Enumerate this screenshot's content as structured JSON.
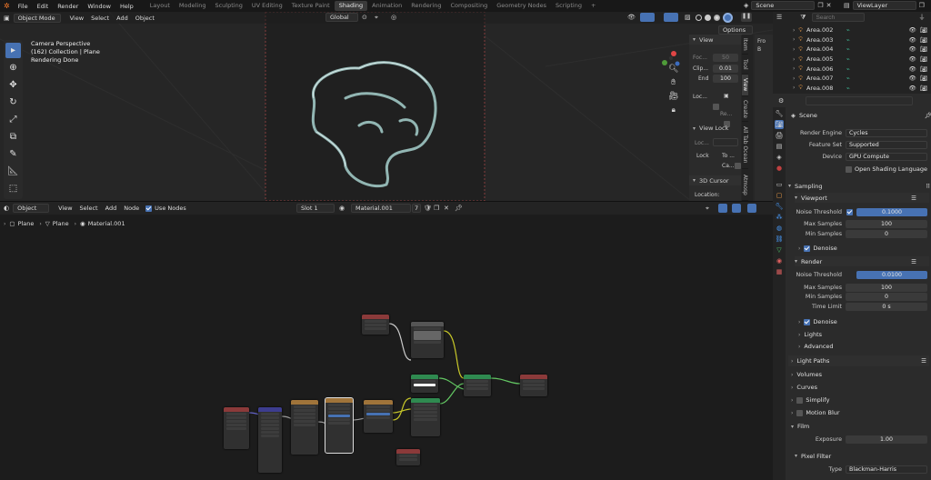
{
  "app_menu": [
    "File",
    "Edit",
    "Render",
    "Window",
    "Help"
  ],
  "workspaces": [
    "Layout",
    "Modeling",
    "Sculpting",
    "UV Editing",
    "Texture Paint",
    "Shading",
    "Animation",
    "Rendering",
    "Compositing",
    "Geometry Nodes",
    "Scripting",
    "+"
  ],
  "active_workspace": "Shading",
  "scene_name": "Scene",
  "view_layer": "ViewLayer",
  "viewport": {
    "mode": "Object Mode",
    "menus": [
      "View",
      "Select",
      "Add",
      "Object"
    ],
    "orientation": "Global",
    "options_label": "Options",
    "info": [
      "Camera Perspective",
      "(162) Collection | Plane",
      "Rendering Done"
    ]
  },
  "npanel": {
    "title": "View",
    "focal_label": "Foc...",
    "focal_value": "50",
    "clip_start_label": "Clip...",
    "clip_start_value": "0.01",
    "end_label": "End",
    "end_value": "100",
    "local_label": "Loc...",
    "render_label": "Re...",
    "view_lock": "View Lock",
    "lock_obj_label": "Loc...",
    "lock_label": "Lock",
    "to_label": "To ...",
    "cam_label": "Ca...",
    "cursor_title": "3D Cursor",
    "location_label": "Location:",
    "tabs": [
      "Item",
      "Tool",
      "View",
      "Create",
      "All Tab Ocean",
      "Atmosp"
    ],
    "active_tab": "View"
  },
  "node_editor": {
    "type": "Object",
    "menus": [
      "View",
      "Select",
      "Add",
      "Node"
    ],
    "use_nodes": "Use Nodes",
    "slot": "Slot 1",
    "material": "Material.001",
    "users": "7",
    "breadcrumb": [
      "Plane",
      "Plane",
      "Material.001"
    ]
  },
  "outliner": {
    "search_placeholder": "Search",
    "items": [
      "Area.002",
      "Area.003",
      "Area.004",
      "Area.005",
      "Area.006",
      "Area.007",
      "Area.008"
    ]
  },
  "properties": {
    "search_placeholder": "",
    "context": "Scene",
    "render_engine_label": "Render Engine",
    "render_engine": "Cycles",
    "feature_set_label": "Feature Set",
    "feature_set": "Supported",
    "device_label": "Device",
    "device": "GPU Compute",
    "osl_label": "Open Shading Language",
    "sampling": "Sampling",
    "viewport_sub": "Viewport",
    "noise_threshold_label": "Noise Threshold",
    "vp_noise_threshold": "0.1000",
    "max_samples_label": "Max Samples",
    "vp_max_samples": "100",
    "min_samples_label": "Min Samples",
    "vp_min_samples": "0",
    "denoise_label": "Denoise",
    "render_sub": "Render",
    "r_noise_threshold": "0.0100",
    "r_max_samples": "100",
    "r_min_samples": "0",
    "time_limit_label": "Time Limit",
    "time_limit": "0 s",
    "lights": "Lights",
    "advanced": "Advanced",
    "light_paths": "Light Paths",
    "volumes": "Volumes",
    "curves": "Curves",
    "simplify": "Simplify",
    "motion_blur": "Motion Blur",
    "film": "Film",
    "exposure_label": "Exposure",
    "exposure": "1.00",
    "pixel_filter": "Pixel Filter",
    "type_label": "Type",
    "type_value": "Blackman-Harris"
  },
  "colors": {
    "accent": "#4772b3",
    "background": "#1d1d1d",
    "panel": "#2b2b2b",
    "outline_green": "#3fbf9a"
  }
}
